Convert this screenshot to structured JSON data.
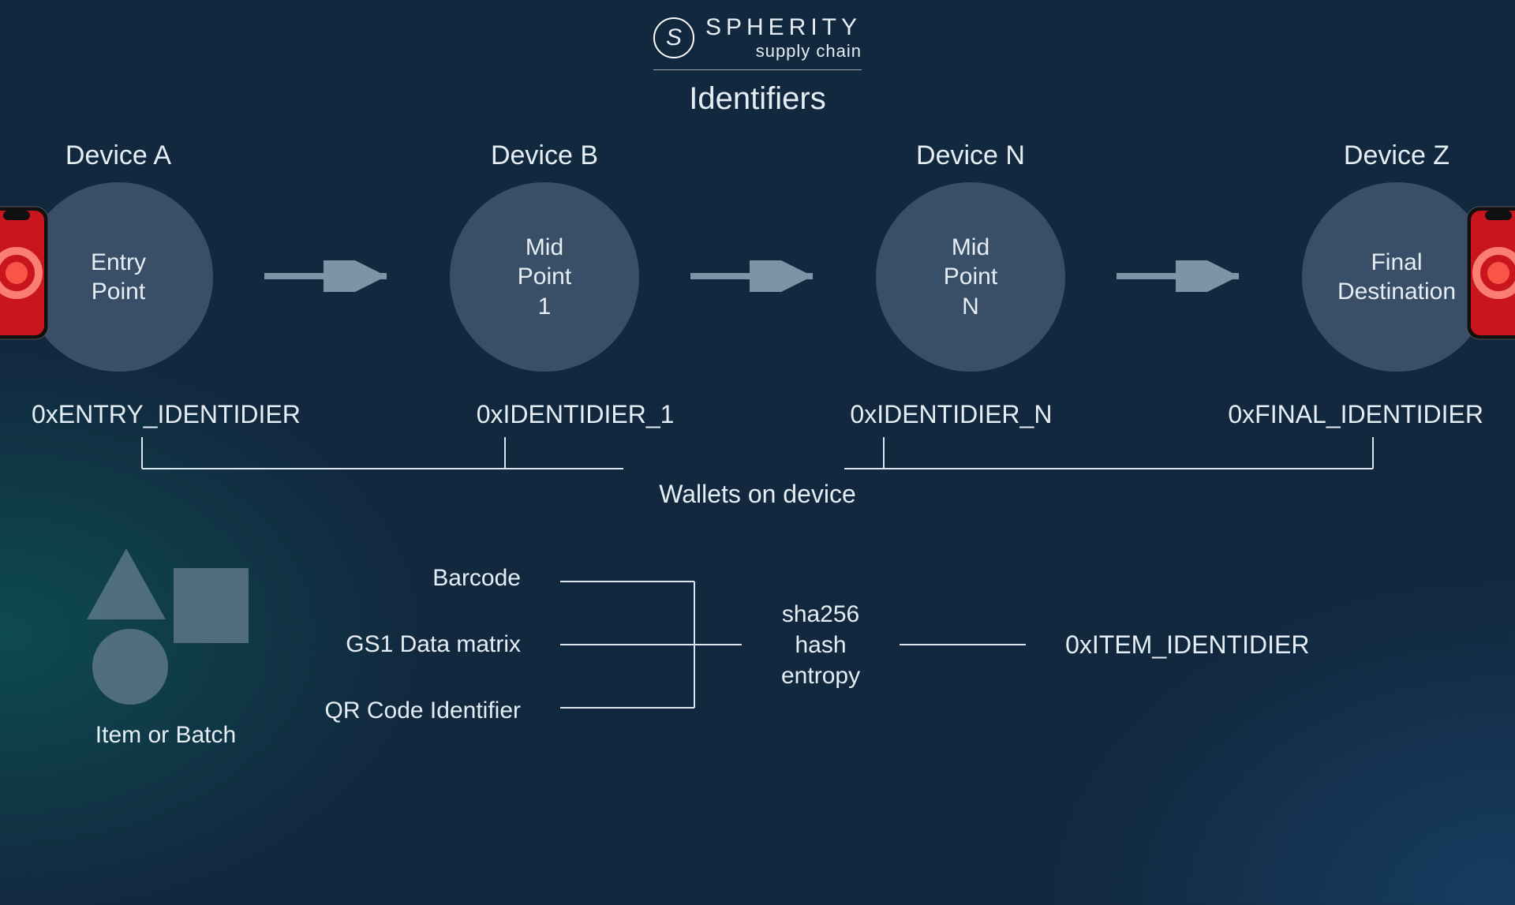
{
  "brand": {
    "name": "SPHERITY",
    "sub": "supply chain"
  },
  "title": "Identifiers",
  "nodes": [
    {
      "device": "Device A",
      "label": "Entry\nPoint",
      "id": "0xENTRY_IDENTIDIER"
    },
    {
      "device": "Device B",
      "label": "Mid\nPoint\n1",
      "id": "0xIDENTIDIER_1"
    },
    {
      "device": "Device N",
      "label": "Mid\nPoint\nN",
      "id": "0xIDENTIDIER_N"
    },
    {
      "device": "Device Z",
      "label": "Final\nDestination",
      "id": "0xFINAL_IDENTIDIER"
    }
  ],
  "wallets_label": "Wallets on device",
  "shapes_label": "Item or Batch",
  "id_types": {
    "a": "Barcode",
    "b": "GS1 Data matrix",
    "c": "QR Code Identifier"
  },
  "hash_label": "sha256\nhash\nentropy",
  "item_id": "0xITEM_IDENTIDIER"
}
